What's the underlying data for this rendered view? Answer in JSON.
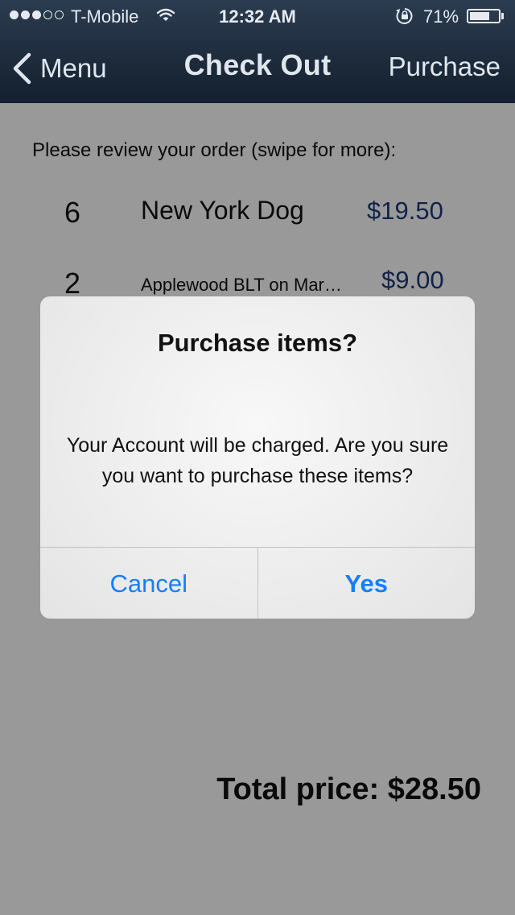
{
  "status_bar": {
    "carrier": "T-Mobile",
    "time": "12:32 AM",
    "battery_percent": "71%",
    "battery_level": 0.71,
    "signal_bars_filled": 3,
    "signal_bars_total": 5,
    "icons": [
      "wifi-icon",
      "orientation-lock-icon",
      "battery-icon"
    ]
  },
  "nav": {
    "back_label": "Menu",
    "title": "Check Out",
    "action_label": "Purchase"
  },
  "order": {
    "review_label": "Please review your order (swipe for more):",
    "items": [
      {
        "qty": "6",
        "name": "New York Dog",
        "price": "$19.50"
      },
      {
        "qty": "2",
        "name": "Applewood BLT on Marble Rye",
        "price": "$9.00"
      }
    ],
    "total_label": "Total price: $28.50"
  },
  "alert": {
    "title": "Purchase items?",
    "message": "Your Account will be charged. Are you sure you want to purchase these items?",
    "cancel_label": "Cancel",
    "confirm_label": "Yes"
  },
  "colors": {
    "nav_background": "#1a2838",
    "price_text": "#1e3a7a",
    "alert_button_text": "#157efb"
  }
}
